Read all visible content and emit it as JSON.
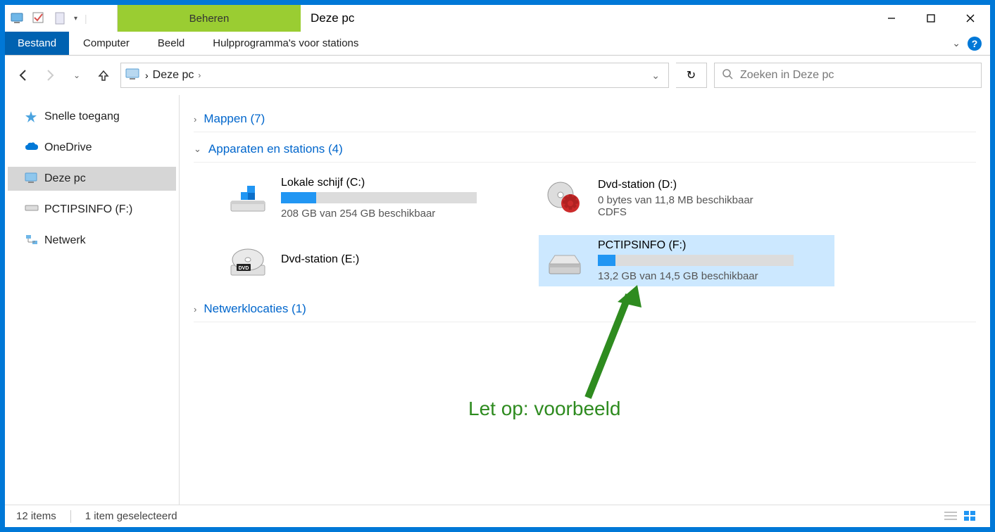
{
  "title": {
    "beheren": "Beheren",
    "app_title": "Deze pc"
  },
  "ribbon": {
    "file": "Bestand",
    "computer": "Computer",
    "view": "Beeld",
    "context_tab": "Hulpprogramma's voor stations"
  },
  "address": {
    "crumb": "Deze pc"
  },
  "search": {
    "placeholder": "Zoeken in Deze pc"
  },
  "sidebar": {
    "items": [
      {
        "label": "Snelle toegang"
      },
      {
        "label": "OneDrive"
      },
      {
        "label": "Deze pc"
      },
      {
        "label": "PCTIPSINFO (F:)"
      },
      {
        "label": "Netwerk"
      }
    ]
  },
  "sections": {
    "folders": "Mappen (7)",
    "devices": "Apparaten en stations (4)",
    "network": "Netwerklocaties (1)"
  },
  "drives": [
    {
      "name": "Lokale schijf (C:)",
      "sub": "208 GB van 254 GB beschikbaar",
      "fill_pct": 18
    },
    {
      "name": "Dvd-station (D:)",
      "sub": "0 bytes van 11,8 MB beschikbaar",
      "sub2": "CDFS"
    },
    {
      "name": "Dvd-station (E:)"
    },
    {
      "name": "PCTIPSINFO (F:)",
      "sub": "13,2 GB van 14,5 GB beschikbaar",
      "fill_pct": 9,
      "selected": true
    }
  ],
  "annotation": {
    "text": "Let op: voorbeeld"
  },
  "status": {
    "items": "12 items",
    "selected": "1 item geselecteerd"
  }
}
